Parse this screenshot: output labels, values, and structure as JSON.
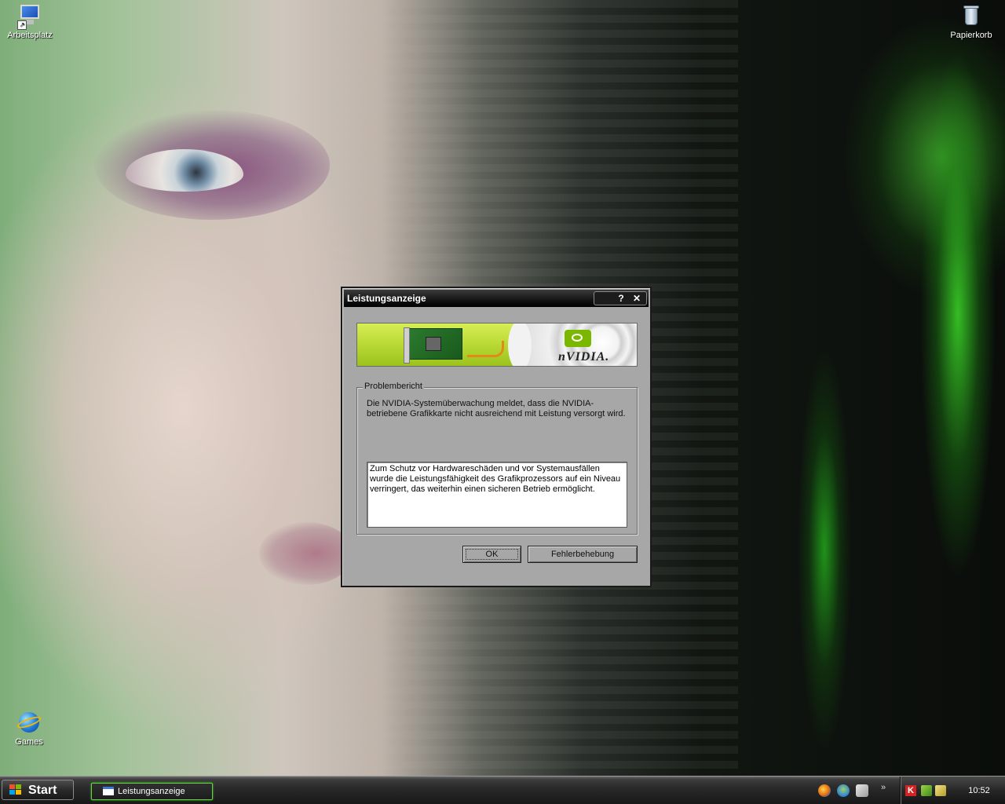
{
  "desktop": {
    "icons": {
      "my_computer": "Arbeitsplatz",
      "recycle_bin": "Papierkorb",
      "games": "Games"
    }
  },
  "dialog": {
    "title": "Leistungsanzeige",
    "help_glyph": "?",
    "close_glyph": "✕",
    "banner": {
      "brand": "nVIDIA.",
      "logo_icon": "nvidia-eye-icon",
      "image_icon": "graphics-card-icon"
    },
    "group_label": "Problembericht",
    "message": "Die NVIDIA-Systemüberwachung meldet, dass die NVIDIA-betriebene Grafikkarte nicht ausreichend mit Leistung versorgt wird.",
    "details": "Zum Schutz vor Hardwareschäden und vor Systemausfällen wurde die Leistungsfähigkeit des Grafikprozessors auf ein Niveau verringert, das weiterhin einen sicheren Betrieb ermöglicht.",
    "buttons": {
      "ok": "OK",
      "troubleshoot": "Fehlerbehebung"
    }
  },
  "taskbar": {
    "start_label": "Start",
    "task_label": "Leistungsanzeige",
    "quick_launch_more": "»",
    "tray_kaspersky": "K",
    "clock": "10:52"
  },
  "colors": {
    "dialog_bg": "#a7a7a7",
    "title_bar": "#141414",
    "taskbar": "#1e1e1e",
    "active_task_glow": "#64d33a",
    "nvidia_green": "#7ab800"
  }
}
